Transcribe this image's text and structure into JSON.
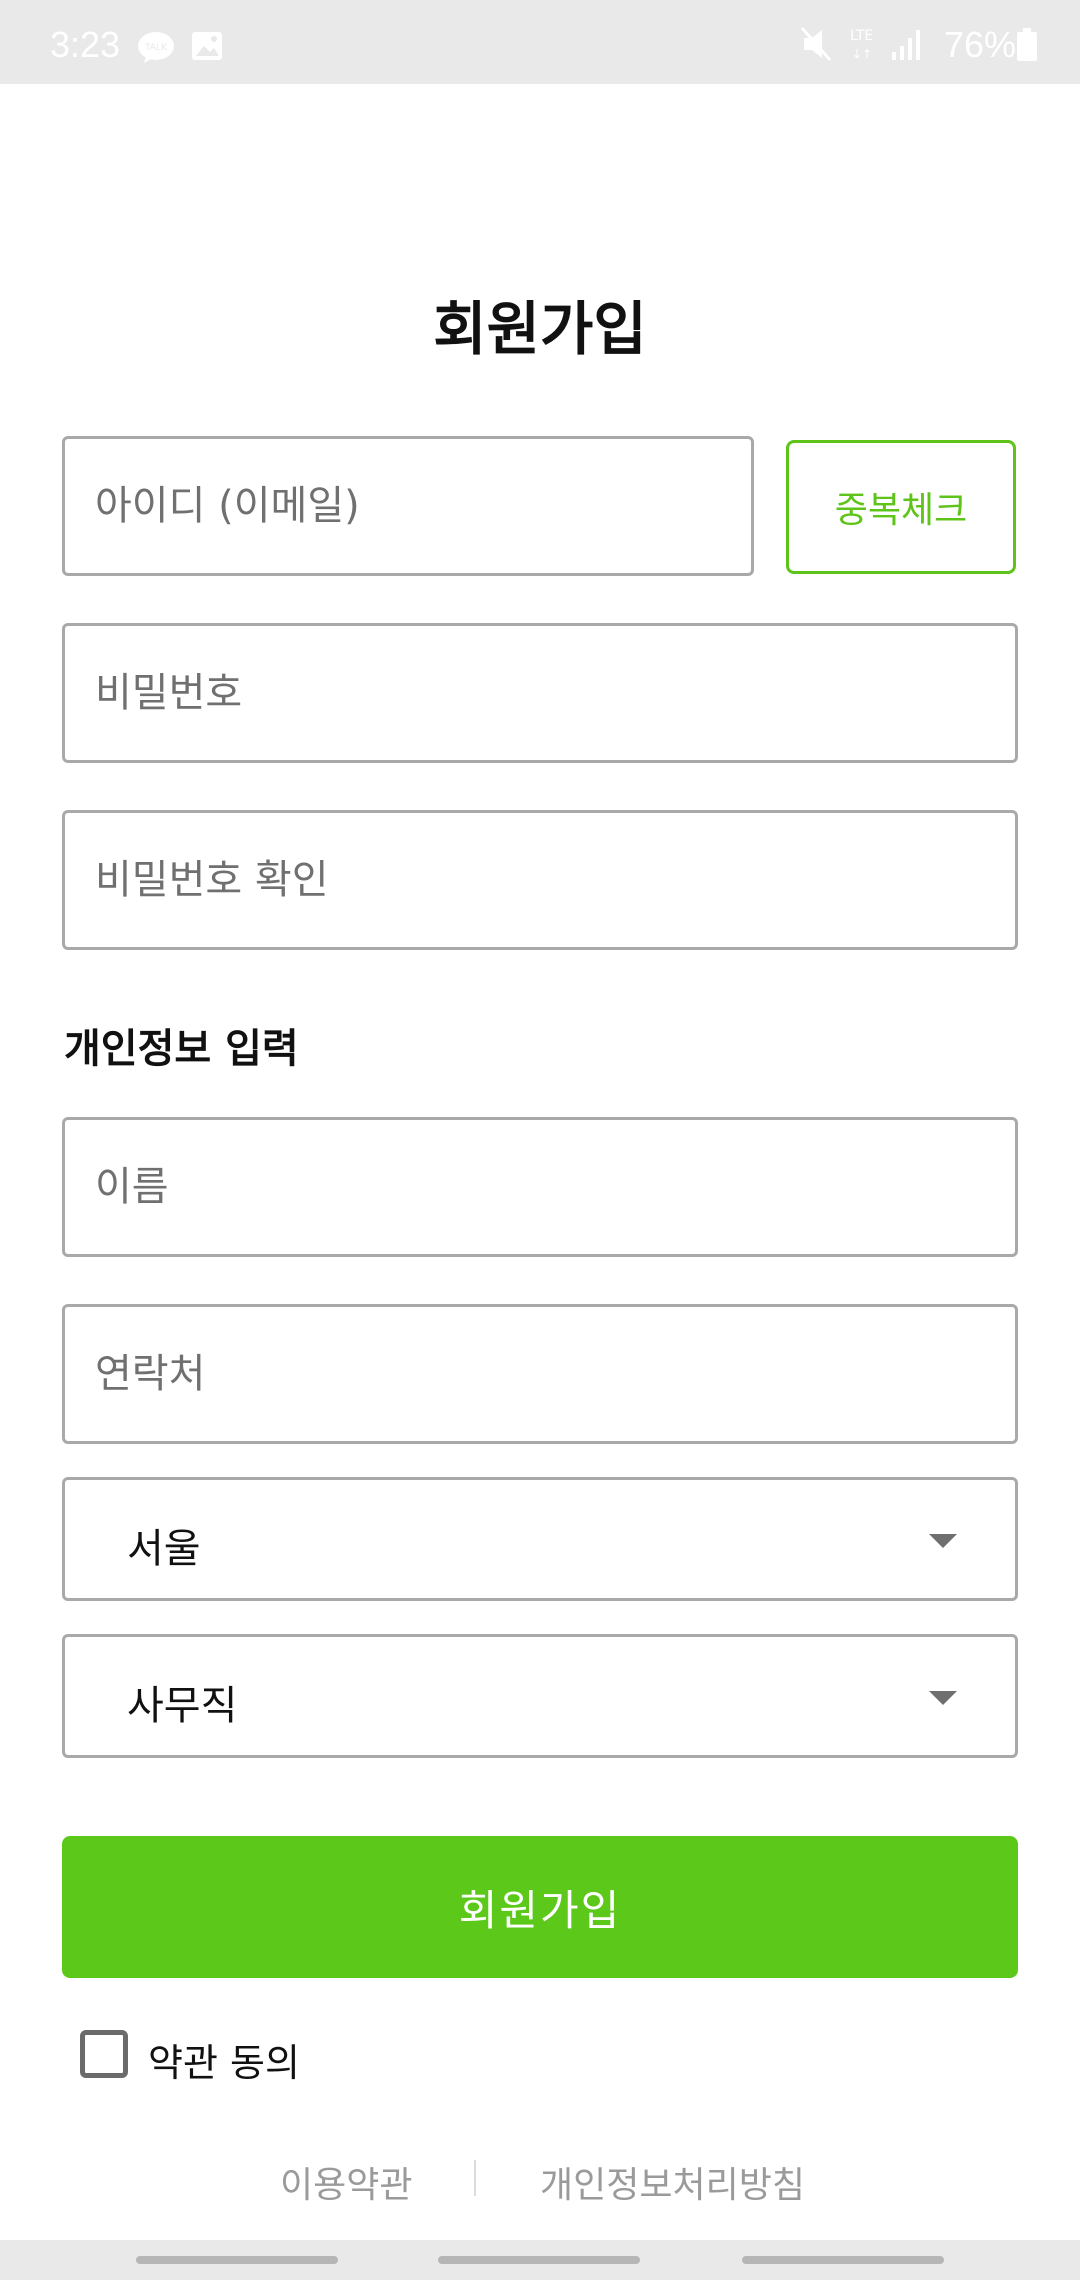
{
  "status_bar": {
    "time": "3:23",
    "battery": "76%",
    "icons": [
      "talk-icon",
      "image-icon",
      "mute-icon",
      "lte-icon",
      "signal-icon",
      "battery-icon"
    ]
  },
  "title": "회원가입",
  "form": {
    "id_placeholder": "아이디 (이메일)",
    "duplicate_check_label": "중복체크",
    "password_placeholder": "비밀번호",
    "password_confirm_placeholder": "비밀번호 확인",
    "personal_section_label": "개인정보 입력",
    "name_placeholder": "이름",
    "phone_placeholder": "연락처",
    "region_select": "서울",
    "job_select": "사무직",
    "submit_label": "회원가입",
    "agree_label": "약관 동의",
    "agree_checked": false
  },
  "footer": {
    "terms_link": "이용약관",
    "privacy_link": "개인정보처리방침"
  },
  "colors": {
    "accent": "#5cc81a",
    "border": "#a9a9a9",
    "status_bar": "#e9e9e9"
  }
}
